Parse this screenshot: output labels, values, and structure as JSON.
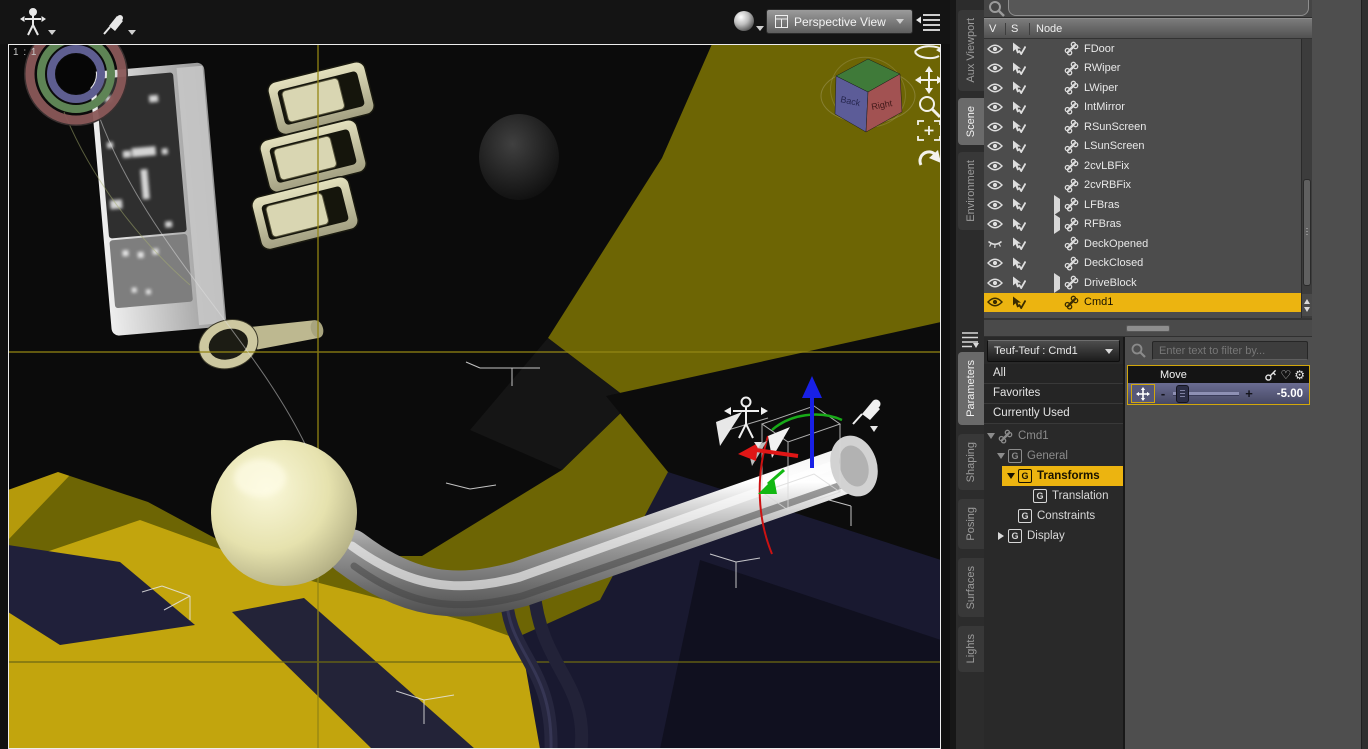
{
  "colors": {
    "accent_yellow": "#ecb410",
    "viewport_olive": "#6d6504",
    "floor_yellow": "#c2a50d",
    "slider_blue": "#585a80"
  },
  "viewport": {
    "zoom_ratio_label": "1 : 1",
    "view_selector_label": "Perspective View",
    "cube": {
      "left_face": "Back",
      "right_face": "Right"
    }
  },
  "right_panel": {
    "top_tabs": [
      {
        "label": "Aux Viewport",
        "active": false
      },
      {
        "label": "Scene",
        "active": true
      },
      {
        "label": "Environment",
        "active": false
      }
    ],
    "bottom_tabs": [
      {
        "label": "Parameters",
        "active": true
      },
      {
        "label": "Shaping",
        "active": false
      },
      {
        "label": "Posing",
        "active": false
      },
      {
        "label": "Surfaces",
        "active": false
      },
      {
        "label": "Lights",
        "active": false
      }
    ]
  },
  "scene_panel": {
    "columns": {
      "v": "V",
      "s": "S",
      "node": "Node"
    },
    "nodes": [
      {
        "label": "FDoor",
        "eye": "open",
        "expandable": false,
        "selected": false
      },
      {
        "label": "RWiper",
        "eye": "open",
        "expandable": false,
        "selected": false
      },
      {
        "label": "LWiper",
        "eye": "open",
        "expandable": false,
        "selected": false
      },
      {
        "label": "IntMirror",
        "eye": "open",
        "expandable": false,
        "selected": false
      },
      {
        "label": "RSunScreen",
        "eye": "open",
        "expandable": false,
        "selected": false
      },
      {
        "label": "LSunScreen",
        "eye": "open",
        "expandable": false,
        "selected": false
      },
      {
        "label": "2cvLBFix",
        "eye": "open",
        "expandable": false,
        "selected": false
      },
      {
        "label": "2cvRBFix",
        "eye": "open",
        "expandable": false,
        "selected": false
      },
      {
        "label": "LFBras",
        "eye": "open",
        "expandable": true,
        "selected": false
      },
      {
        "label": "RFBras",
        "eye": "open",
        "expandable": true,
        "selected": false
      },
      {
        "label": "DeckOpened",
        "eye": "closed",
        "expandable": false,
        "selected": false
      },
      {
        "label": "DeckClosed",
        "eye": "open",
        "expandable": false,
        "selected": false
      },
      {
        "label": "DriveBlock",
        "eye": "open",
        "expandable": true,
        "selected": false
      },
      {
        "label": "Cmd1",
        "eye": "open",
        "expandable": false,
        "selected": true
      }
    ]
  },
  "parameters_panel": {
    "scope_selector": "Teuf-Teuf : Cmd1",
    "filters": [
      "All",
      "Favorites",
      "Currently Used"
    ],
    "group_icon_letter": "G",
    "tree": [
      {
        "label": "Cmd1",
        "icon": "bone",
        "arrow": "down",
        "depth": 0,
        "dim": true,
        "selected": false
      },
      {
        "label": "General",
        "icon": "group",
        "arrow": "down",
        "depth": 1,
        "dim": true,
        "selected": false
      },
      {
        "label": "Transforms",
        "icon": "group",
        "arrow": "down",
        "depth": 2,
        "dim": false,
        "selected": true
      },
      {
        "label": "Translation",
        "icon": "group",
        "arrow": "none",
        "depth": 3,
        "dim": false,
        "selected": false
      },
      {
        "label": "Constraints",
        "icon": "group",
        "arrow": "none",
        "depth": 2,
        "dim": false,
        "selected": false
      },
      {
        "label": "Display",
        "icon": "group",
        "arrow": "right",
        "depth": 1,
        "dim": false,
        "selected": false
      }
    ],
    "filter_input_placeholder": "Enter text to filter by...",
    "parameter": {
      "label": "Move",
      "value": "-5.00",
      "minus_label": "-",
      "plus_label": "+"
    }
  }
}
